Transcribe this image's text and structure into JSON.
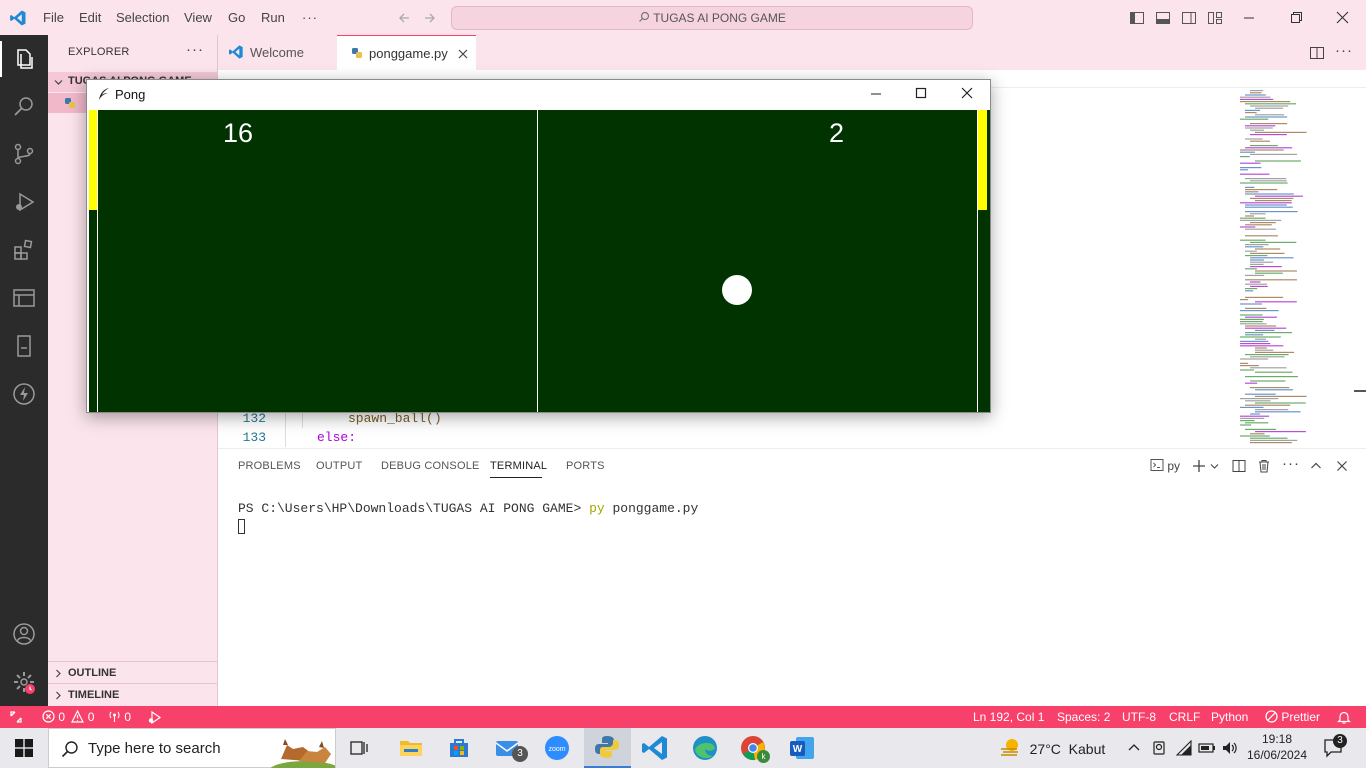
{
  "titlebar": {
    "menu": [
      "File",
      "Edit",
      "Selection",
      "View",
      "Go",
      "Run"
    ],
    "overflow": "···",
    "search_text": "TUGAS AI PONG GAME"
  },
  "sidebar": {
    "title": "EXPLORER",
    "more": "···",
    "folder": "TUGAS AI PONG GAME",
    "outline": "OUTLINE",
    "timeline": "TIMELINE"
  },
  "tabs": [
    {
      "label": "Welcome"
    },
    {
      "label": "ponggame.py",
      "active": true
    }
  ],
  "editor": {
    "lines": [
      {
        "num": "132",
        "code": "spawn_ball()"
      },
      {
        "num": "133",
        "code": "else:"
      }
    ]
  },
  "panel": {
    "tabs": [
      "PROBLEMS",
      "OUTPUT",
      "DEBUG CONSOLE",
      "TERMINAL",
      "PORTS"
    ],
    "active_tab": "TERMINAL",
    "shell_label": "py",
    "terminal_prompt": "PS C:\\Users\\HP\\Downloads\\TUGAS AI PONG GAME> ",
    "terminal_cmd_1": "py",
    "terminal_cmd_2": " ponggame.py"
  },
  "statusbar": {
    "errors": "0",
    "warnings": "0",
    "ports": "0",
    "position": "Ln 192, Col 1",
    "spaces": "Spaces: 2",
    "encoding": "UTF-8",
    "eol": "CRLF",
    "language": "Python",
    "formatter": "Prettier"
  },
  "pong": {
    "title": "Pong",
    "score_left": "16",
    "score_right": "2",
    "colors": {
      "field": "#003300",
      "paddle": "#ffff00",
      "ball": "#ffffff"
    }
  },
  "taskbar": {
    "search_placeholder": "Type here to search",
    "mail_badge": "3",
    "weather": "27°C  Kabut",
    "time": "19:18",
    "date": "16/06/2024",
    "notifications": "3"
  },
  "colors": {
    "accent": "#f7416a",
    "chrome": "#fbe4ec",
    "activity_bar": "#2b2b2b"
  }
}
